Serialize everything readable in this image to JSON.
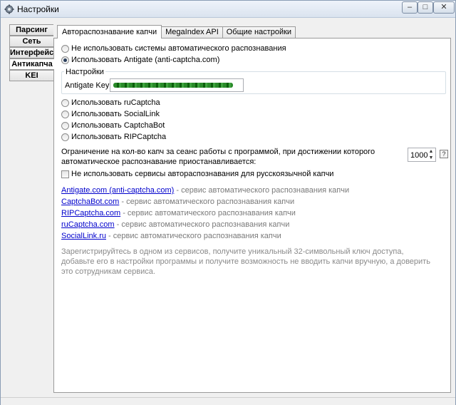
{
  "window": {
    "title": "Настройки",
    "controls": {
      "minimize": "–",
      "maximize": "□",
      "close": "✕"
    }
  },
  "left_tabs": [
    {
      "label": "Парсинг",
      "active": false
    },
    {
      "label": "Сеть",
      "active": false
    },
    {
      "label": "Интерфейс",
      "active": false
    },
    {
      "label": "Антикапча",
      "active": true
    },
    {
      "label": "KEI",
      "active": false
    }
  ],
  "top_tabs": [
    {
      "label": "Автораспознавание капчи",
      "active": true
    },
    {
      "label": "MegaIndex API",
      "active": false
    },
    {
      "label": "Общие настройки",
      "active": false
    }
  ],
  "options": {
    "no_auto": {
      "label": "Не использовать системы автоматического распознавания",
      "checked": false
    },
    "antigate": {
      "label": "Использовать Antigate (anti-captcha.com)",
      "checked": true
    }
  },
  "settings_group": {
    "label": "Настройки",
    "key_label": "Antigate Key:"
  },
  "services": [
    {
      "label": "Использовать ruCaptcha",
      "checked": false
    },
    {
      "label": "Использовать SocialLink",
      "checked": false
    },
    {
      "label": "Использовать CaptchaBot",
      "checked": false
    },
    {
      "label": "Использовать RIPCaptcha",
      "checked": false
    }
  ],
  "limit": {
    "text": "Ограничение на кол-во капч за сеанс работы с программой, при достижении которого автоматическое распознавание приостанавливается:",
    "value": "1000",
    "help": "?"
  },
  "russian_checkbox": {
    "label": "Не использовать сервисы автораспознавания для русскоязычной капчи",
    "checked": false
  },
  "links": [
    {
      "link": "Antigate.com (anti-captcha.com)",
      "desc": " - сервис автоматического распознавания капчи"
    },
    {
      "link": "CaptchaBot.com",
      "desc": " - сервис автоматического распознавания капчи"
    },
    {
      "link": "RIPCaptcha.com",
      "desc": " - сервис автоматического распознавания капчи"
    },
    {
      "link": "ruCaptcha.com",
      "desc": " - сервис автоматического распознавания капчи"
    },
    {
      "link": "SocialLink.ru",
      "desc": " - сервис автоматического распознавания капчи"
    }
  ],
  "footnote": "Зарегистрируйтесь в одном из сервисов, получите уникальный 32-символьный ключ доступа, добавьте его в настройки программы и получите возможность не вводить капчи вручную, а доверить это сотрудникам сервиса."
}
